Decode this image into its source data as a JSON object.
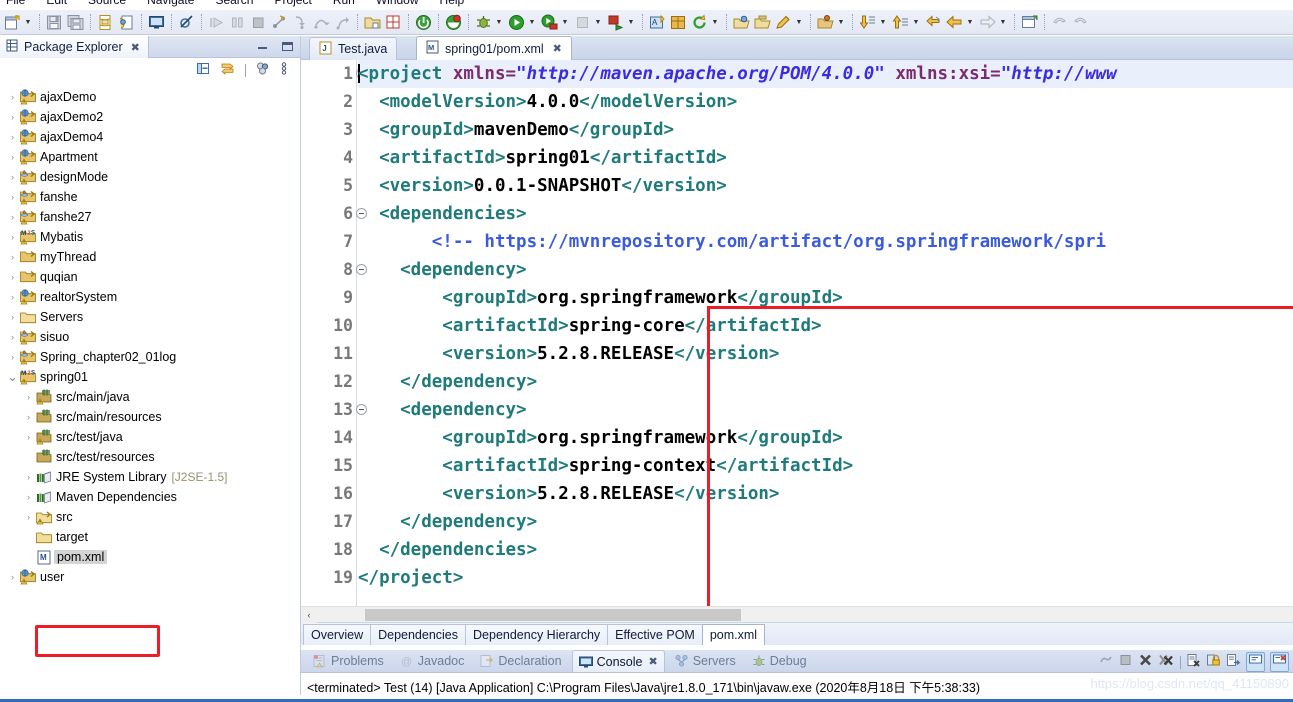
{
  "window": {
    "menus": [
      "File",
      "Edit",
      "Source",
      "Navigate",
      "Search",
      "Project",
      "Run",
      "Window",
      "Help"
    ]
  },
  "toolbar": {
    "groups": [
      {
        "items": [
          {
            "name": "new-icon",
            "glyph": "new"
          },
          {
            "name": "new-dropdown-arrow-icon",
            "glyph": "arrow"
          }
        ]
      },
      {
        "items": [
          {
            "name": "save-icon",
            "glyph": "save"
          },
          {
            "name": "save-all-icon",
            "glyph": "saveall"
          }
        ]
      },
      {
        "items": [
          {
            "name": "print-icon",
            "glyph": "print"
          },
          {
            "name": "build-all-icon",
            "glyph": "buildall"
          }
        ]
      },
      {
        "items": [
          {
            "name": "open-console-icon",
            "glyph": "console"
          }
        ]
      },
      {
        "items": [
          {
            "name": "skip-breakpoints-icon",
            "glyph": "skipbp"
          }
        ]
      },
      {
        "items": [
          {
            "name": "resume-icon",
            "glyph": "resume"
          },
          {
            "name": "suspend-icon",
            "glyph": "suspend"
          },
          {
            "name": "terminate-icon",
            "glyph": "terminate"
          },
          {
            "name": "disconnect-icon",
            "glyph": "disconnect"
          },
          {
            "name": "step-into-icon",
            "glyph": "stepinto"
          },
          {
            "name": "step-over-icon",
            "glyph": "stepover"
          },
          {
            "name": "step-return-icon",
            "glyph": "stepreturn"
          }
        ]
      },
      {
        "items": [
          {
            "name": "new-java-project-icon",
            "glyph": "javaproj"
          },
          {
            "name": "new-class-icon",
            "glyph": "newclass"
          }
        ]
      },
      {
        "items": [
          {
            "name": "server-start-icon",
            "glyph": "power"
          }
        ]
      },
      {
        "items": [
          {
            "name": "tomcat-icon",
            "glyph": "tomcat"
          }
        ]
      },
      {
        "items": [
          {
            "name": "debug-icon",
            "glyph": "debug"
          },
          {
            "name": "debug-dropdown-arrow-icon",
            "glyph": "arrow"
          },
          {
            "name": "run-icon",
            "glyph": "run"
          },
          {
            "name": "run-dropdown-arrow-icon",
            "glyph": "arrow"
          },
          {
            "name": "run-server-icon",
            "glyph": "runserver"
          },
          {
            "name": "run-server-dropdown-arrow-icon",
            "glyph": "arrow"
          },
          {
            "name": "stop-icon",
            "glyph": "stopgrey"
          },
          {
            "name": "stop-dropdown-arrow-icon",
            "glyph": "arrow"
          },
          {
            "name": "run-last-icon",
            "glyph": "runlast"
          },
          {
            "name": "run-last-dropdown-arrow-icon",
            "glyph": "arrow"
          }
        ]
      },
      {
        "items": [
          {
            "name": "new-annotation-icon",
            "glyph": "annot"
          },
          {
            "name": "new-package-icon",
            "glyph": "package"
          },
          {
            "name": "refresh-icon",
            "glyph": "refresh"
          },
          {
            "name": "refresh-dropdown-arrow-icon",
            "glyph": "arrow"
          }
        ]
      },
      {
        "items": [
          {
            "name": "open-type-icon",
            "glyph": "opentype"
          },
          {
            "name": "open-task-icon",
            "glyph": "opentask"
          },
          {
            "name": "search-icon",
            "glyph": "pen"
          },
          {
            "name": "search-dropdown-arrow-icon",
            "glyph": "arrow"
          }
        ]
      },
      {
        "items": [
          {
            "name": "open-resource-icon",
            "glyph": "openres"
          },
          {
            "name": "open-resource-dropdown-arrow-icon",
            "glyph": "arrow"
          }
        ]
      },
      {
        "items": [
          {
            "name": "next-annotation-icon",
            "glyph": "downarrow"
          },
          {
            "name": "next-annotation-dropdown-arrow-icon",
            "glyph": "arrow"
          },
          {
            "name": "previous-annotation-icon",
            "glyph": "uparrow"
          },
          {
            "name": "previous-annotation-dropdown-arrow-icon",
            "glyph": "arrow"
          },
          {
            "name": "last-edit-location-icon",
            "glyph": "lastedit"
          },
          {
            "name": "back-icon",
            "glyph": "back"
          },
          {
            "name": "back-dropdown-arrow-icon",
            "glyph": "arrow"
          },
          {
            "name": "forward-icon",
            "glyph": "forward"
          },
          {
            "name": "forward-dropdown-arrow-icon",
            "glyph": "arrow"
          }
        ]
      },
      {
        "items": [
          {
            "name": "open-perspective-icon",
            "glyph": "perspective"
          }
        ]
      },
      {
        "items": [
          {
            "name": "undo-icon",
            "glyph": "undo"
          },
          {
            "name": "redo-icon",
            "glyph": "redo"
          }
        ]
      }
    ]
  },
  "package_explorer": {
    "title": "Package Explorer",
    "close_label": "✖",
    "toolbar": [
      {
        "name": "collapse-all-icon"
      },
      {
        "name": "link-with-editor-icon"
      },
      {
        "name": "view-menu-filters-icon"
      },
      {
        "name": "view-menu-icon"
      }
    ],
    "window_buttons": [
      {
        "name": "minimize-button",
        "label": "—"
      },
      {
        "name": "maximize-button",
        "label": "❐"
      }
    ],
    "tree": [
      {
        "label": "ajaxDemo",
        "icon": "web-project",
        "twisty": "collapsed",
        "indent": 0
      },
      {
        "label": "ajaxDemo2",
        "icon": "web-project",
        "twisty": "collapsed",
        "indent": 0
      },
      {
        "label": "ajaxDemo4",
        "icon": "web-project",
        "twisty": "collapsed",
        "indent": 0
      },
      {
        "label": "Apartment",
        "icon": "web-project",
        "twisty": "collapsed",
        "indent": 0
      },
      {
        "label": "designMode",
        "icon": "java-project",
        "twisty": "collapsed",
        "indent": 0
      },
      {
        "label": "fanshe",
        "icon": "java-project",
        "twisty": "collapsed",
        "indent": 0
      },
      {
        "label": "fanshe27",
        "icon": "java-project",
        "twisty": "collapsed",
        "indent": 0
      },
      {
        "label": "Mybatis",
        "icon": "maven-project",
        "twisty": "collapsed",
        "indent": 0
      },
      {
        "label": "myThread",
        "icon": "plain-project",
        "twisty": "collapsed",
        "indent": 0
      },
      {
        "label": "quqian",
        "icon": "plain-project",
        "twisty": "collapsed",
        "indent": 0
      },
      {
        "label": "realtorSystem",
        "icon": "web-project",
        "twisty": "collapsed",
        "indent": 0
      },
      {
        "label": "Servers",
        "icon": "folder",
        "twisty": "collapsed",
        "indent": 0
      },
      {
        "label": "sisuo",
        "icon": "java-project",
        "twisty": "collapsed",
        "indent": 0
      },
      {
        "label": "Spring_chapter02_01log",
        "icon": "java-project",
        "twisty": "collapsed",
        "indent": 0
      },
      {
        "label": "spring01",
        "icon": "maven-project",
        "twisty": "expanded",
        "indent": 0
      },
      {
        "label": "src/main/java",
        "icon": "source-folder",
        "twisty": "collapsed",
        "indent": 1
      },
      {
        "label": "src/main/resources",
        "icon": "source-folder-plain",
        "twisty": "collapsed",
        "indent": 1
      },
      {
        "label": "src/test/java",
        "icon": "source-folder",
        "twisty": "collapsed",
        "indent": 1
      },
      {
        "label": "src/test/resources",
        "icon": "source-folder-plain",
        "twisty": "none",
        "indent": 1
      },
      {
        "label": "JRE System Library",
        "sub": "[J2SE-1.5]",
        "icon": "library",
        "twisty": "collapsed",
        "indent": 1
      },
      {
        "label": "Maven Dependencies",
        "icon": "library",
        "twisty": "collapsed",
        "indent": 1
      },
      {
        "label": "src",
        "icon": "folder-warn",
        "twisty": "collapsed",
        "indent": 1
      },
      {
        "label": "target",
        "icon": "folder",
        "twisty": "none",
        "indent": 1
      },
      {
        "label": "pom.xml",
        "icon": "maven-file",
        "twisty": "none",
        "indent": 1,
        "selected": true
      },
      {
        "label": "user",
        "icon": "web-project",
        "twisty": "collapsed",
        "indent": 0
      }
    ]
  },
  "editor": {
    "tabs": [
      {
        "label": "Test.java",
        "icon": "java-file-icon",
        "active": false,
        "closable": false
      },
      {
        "label": "spring01/pom.xml",
        "icon": "maven-file-icon",
        "active": true,
        "closable": true,
        "close_label": "✖"
      }
    ],
    "lines": [
      {
        "no": "1",
        "fold": true,
        "highlight": true,
        "tokens": [
          {
            "c": "caret",
            "t": ""
          },
          {
            "c": "tg",
            "t": "<project "
          },
          {
            "c": "at",
            "t": "xmlns="
          },
          {
            "c": "st",
            "t": "\"http://maven.apache.org/POM/4.0.0\""
          },
          {
            "c": "tg",
            "t": " "
          },
          {
            "c": "at",
            "t": "xmlns:xsi="
          },
          {
            "c": "st",
            "t": "\"http://www"
          }
        ]
      },
      {
        "no": "2",
        "fold": false,
        "highlight": false,
        "tokens": [
          {
            "c": "tg",
            "t": "  <modelVersion>"
          },
          {
            "c": "tx",
            "t": "4.0.0"
          },
          {
            "c": "tg",
            "t": "</modelVersion>"
          }
        ]
      },
      {
        "no": "3",
        "fold": false,
        "highlight": false,
        "tokens": [
          {
            "c": "tg",
            "t": "  <groupId>"
          },
          {
            "c": "tx",
            "t": "mavenDemo"
          },
          {
            "c": "tg",
            "t": "</groupId>"
          }
        ]
      },
      {
        "no": "4",
        "fold": false,
        "highlight": false,
        "tokens": [
          {
            "c": "tg",
            "t": "  <artifactId>"
          },
          {
            "c": "tx",
            "t": "spring01"
          },
          {
            "c": "tg",
            "t": "</artifactId>"
          }
        ]
      },
      {
        "no": "5",
        "fold": false,
        "highlight": false,
        "tokens": [
          {
            "c": "tg",
            "t": "  <version>"
          },
          {
            "c": "tx",
            "t": "0.0.1-SNAPSHOT"
          },
          {
            "c": "tg",
            "t": "</version>"
          }
        ]
      },
      {
        "no": "6",
        "fold": true,
        "highlight": false,
        "tokens": [
          {
            "c": "tg",
            "t": "  <dependencies>"
          }
        ]
      },
      {
        "no": "7",
        "fold": false,
        "highlight": false,
        "tokens": [
          {
            "c": "cm",
            "t": "       <!-- https://mvnrepository.com/artifact/org.springframework/spri"
          }
        ]
      },
      {
        "no": "8",
        "fold": true,
        "highlight": false,
        "tokens": [
          {
            "c": "tg",
            "t": "    <dependency>"
          }
        ]
      },
      {
        "no": "9",
        "fold": false,
        "highlight": false,
        "tokens": [
          {
            "c": "tg",
            "t": "        <groupId>"
          },
          {
            "c": "tx",
            "t": "org.springframework"
          },
          {
            "c": "tg",
            "t": "</groupId>"
          }
        ]
      },
      {
        "no": "10",
        "fold": false,
        "highlight": false,
        "tokens": [
          {
            "c": "tg",
            "t": "        <artifactId>"
          },
          {
            "c": "tx",
            "t": "spring-core"
          },
          {
            "c": "tg",
            "t": "</artifactId>"
          }
        ]
      },
      {
        "no": "11",
        "fold": false,
        "highlight": false,
        "tokens": [
          {
            "c": "tg",
            "t": "        <version>"
          },
          {
            "c": "tx",
            "t": "5.2.8.RELEASE"
          },
          {
            "c": "tg",
            "t": "</version>"
          }
        ]
      },
      {
        "no": "12",
        "fold": false,
        "highlight": false,
        "tokens": [
          {
            "c": "tg",
            "t": "    </dependency>"
          }
        ]
      },
      {
        "no": "13",
        "fold": true,
        "highlight": false,
        "tokens": [
          {
            "c": "tg",
            "t": "    <dependency>"
          }
        ]
      },
      {
        "no": "14",
        "fold": false,
        "highlight": false,
        "tokens": [
          {
            "c": "tg",
            "t": "        <groupId>"
          },
          {
            "c": "tx",
            "t": "org.springframework"
          },
          {
            "c": "tg",
            "t": "</groupId>"
          }
        ]
      },
      {
        "no": "15",
        "fold": false,
        "highlight": false,
        "tokens": [
          {
            "c": "tg",
            "t": "        <artifactId>"
          },
          {
            "c": "tx",
            "t": "spring-context"
          },
          {
            "c": "tg",
            "t": "</artifactId>"
          }
        ]
      },
      {
        "no": "16",
        "fold": false,
        "highlight": false,
        "tokens": [
          {
            "c": "tg",
            "t": "        <version>"
          },
          {
            "c": "tx",
            "t": "5.2.8.RELEASE"
          },
          {
            "c": "tg",
            "t": "</version>"
          }
        ]
      },
      {
        "no": "17",
        "fold": false,
        "highlight": false,
        "tokens": [
          {
            "c": "tg",
            "t": "    </dependency>"
          }
        ]
      },
      {
        "no": "18",
        "fold": false,
        "highlight": false,
        "tokens": [
          {
            "c": "tg",
            "t": "  </dependencies>"
          }
        ]
      },
      {
        "no": "19",
        "fold": false,
        "highlight": false,
        "tokens": [
          {
            "c": "tg",
            "t": "</project>"
          }
        ]
      }
    ],
    "form_tabs": [
      {
        "label": "Overview",
        "active": false
      },
      {
        "label": "Dependencies",
        "active": false
      },
      {
        "label": "Dependency Hierarchy",
        "active": false
      },
      {
        "label": "Effective POM",
        "active": false
      },
      {
        "label": "pom.xml",
        "active": true
      }
    ],
    "hscroll": {
      "left_arrow": "‹"
    }
  },
  "console": {
    "tabs": [
      {
        "label": "Problems",
        "icon": "problems-icon",
        "active": false
      },
      {
        "label": "Javadoc",
        "icon": "javadoc-icon",
        "active": false
      },
      {
        "label": "Declaration",
        "icon": "declaration-icon",
        "active": false
      },
      {
        "label": "Console",
        "icon": "console-icon",
        "active": true,
        "close_label": "✖"
      },
      {
        "label": "Servers",
        "icon": "servers-icon",
        "active": false
      },
      {
        "label": "Debug",
        "icon": "debug-icon",
        "active": false
      }
    ],
    "tools": [
      {
        "name": "terminate-all-icon"
      },
      {
        "name": "stop-icon"
      },
      {
        "name": "remove-launch-icon"
      },
      {
        "name": "remove-all-launches-icon"
      },
      {
        "name": "clear-console-icon"
      },
      {
        "name": "scroll-lock-icon"
      },
      {
        "name": "word-wrap-icon"
      },
      {
        "name": "pin-console-icon"
      },
      {
        "name": "display-selected-console-icon"
      }
    ],
    "output": "<terminated> Test (14) [Java Application] C:\\Program Files\\Java\\jre1.8.0_171\\bin\\javaw.exe (2020年8月18日 下午5:38:33)",
    "watermark": "https://blog.csdn.net/qq_41150890"
  },
  "annotations": {
    "highlight_color": "#ee1c25",
    "boxes": [
      {
        "name": "pom-xml-tree-highlight"
      },
      {
        "name": "dependencies-code-highlight"
      }
    ]
  }
}
